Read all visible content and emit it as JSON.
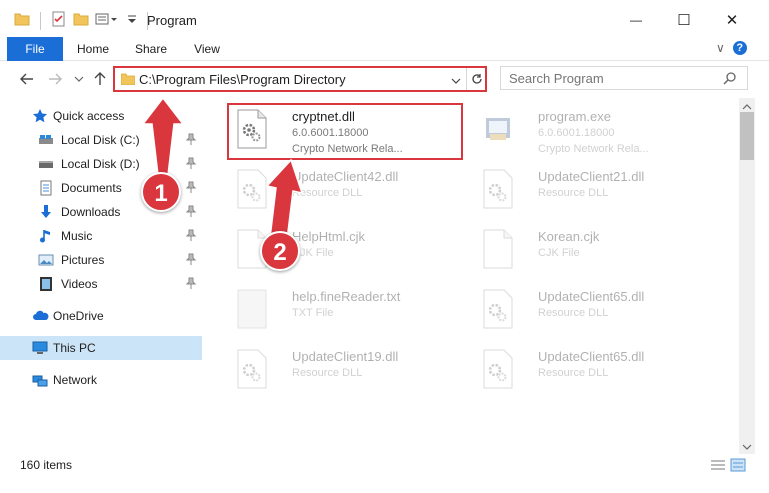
{
  "window": {
    "title": "Program",
    "minimize_glyph": "—",
    "maximize_glyph": "☐",
    "close_glyph": "✕"
  },
  "ribbon": {
    "tabs": [
      {
        "label": "File"
      },
      {
        "label": "Home"
      },
      {
        "label": "Share"
      },
      {
        "label": "View"
      }
    ],
    "help_glyph": "?",
    "collapse_glyph": "∨"
  },
  "address": {
    "path": "C:\\Program Files\\Program Directory"
  },
  "search": {
    "placeholder": "Search Program"
  },
  "sidebar": {
    "quick_access": "Quick access",
    "items": [
      {
        "label": "Local Disk (C:)",
        "icon": "drive-icon",
        "pinned": true
      },
      {
        "label": "Local Disk (D:)",
        "icon": "drive-icon",
        "pinned": true
      },
      {
        "label": "Documents",
        "icon": "documents-icon",
        "pinned": true
      },
      {
        "label": "Downloads",
        "icon": "downloads-icon",
        "pinned": true
      },
      {
        "label": "Music",
        "icon": "music-icon",
        "pinned": true
      },
      {
        "label": "Pictures",
        "icon": "pictures-icon",
        "pinned": true
      },
      {
        "label": "Videos",
        "icon": "videos-icon",
        "pinned": true
      }
    ],
    "onedrive": "OneDrive",
    "this_pc": "This PC",
    "network": "Network"
  },
  "files": [
    {
      "name": "cryptnet.dll",
      "line2": "6.0.6001.18000",
      "line3": "Crypto Network Rela...",
      "icon": "dll-gear-icon",
      "highlighted": true
    },
    {
      "name": "program.exe",
      "line2": "6.0.6001.18000",
      "line3": "Crypto Network Rela...",
      "icon": "exe-icon",
      "highlighted": false
    },
    {
      "name": "UpdateClient42.dll",
      "line2": "Resource DLL",
      "line3": "",
      "icon": "dll-gear-icon",
      "highlighted": false
    },
    {
      "name": "UpdateClient21.dll",
      "line2": "Resource DLL",
      "line3": "",
      "icon": "dll-gear-icon",
      "highlighted": false
    },
    {
      "name": "HelpHtml.cjk",
      "line2": "CJK File",
      "line3": "",
      "icon": "file-icon",
      "highlighted": false
    },
    {
      "name": "Korean.cjk",
      "line2": "CJK File",
      "line3": "",
      "icon": "file-icon",
      "highlighted": false
    },
    {
      "name": "help.fineReader.txt",
      "line2": "TXT File",
      "line3": "",
      "icon": "txt-icon",
      "highlighted": false
    },
    {
      "name": "UpdateClient65.dll",
      "line2": "Resource DLL",
      "line3": "",
      "icon": "dll-gear-icon",
      "highlighted": false
    },
    {
      "name": "UpdateClient19.dll",
      "line2": "Resource DLL",
      "line3": "",
      "icon": "dll-gear-icon",
      "highlighted": false
    },
    {
      "name": "UpdateClient65.dll",
      "line2": "Resource DLL",
      "line3": "",
      "icon": "dll-gear-icon",
      "highlighted": false
    }
  ],
  "status": {
    "item_count": "160 items"
  },
  "annotations": {
    "step1": "1",
    "step2": "2",
    "color": "#d9363e"
  },
  "colors": {
    "accent": "#1a6ed6",
    "selection": "#cce4f7",
    "highlight": "#d9363e"
  }
}
